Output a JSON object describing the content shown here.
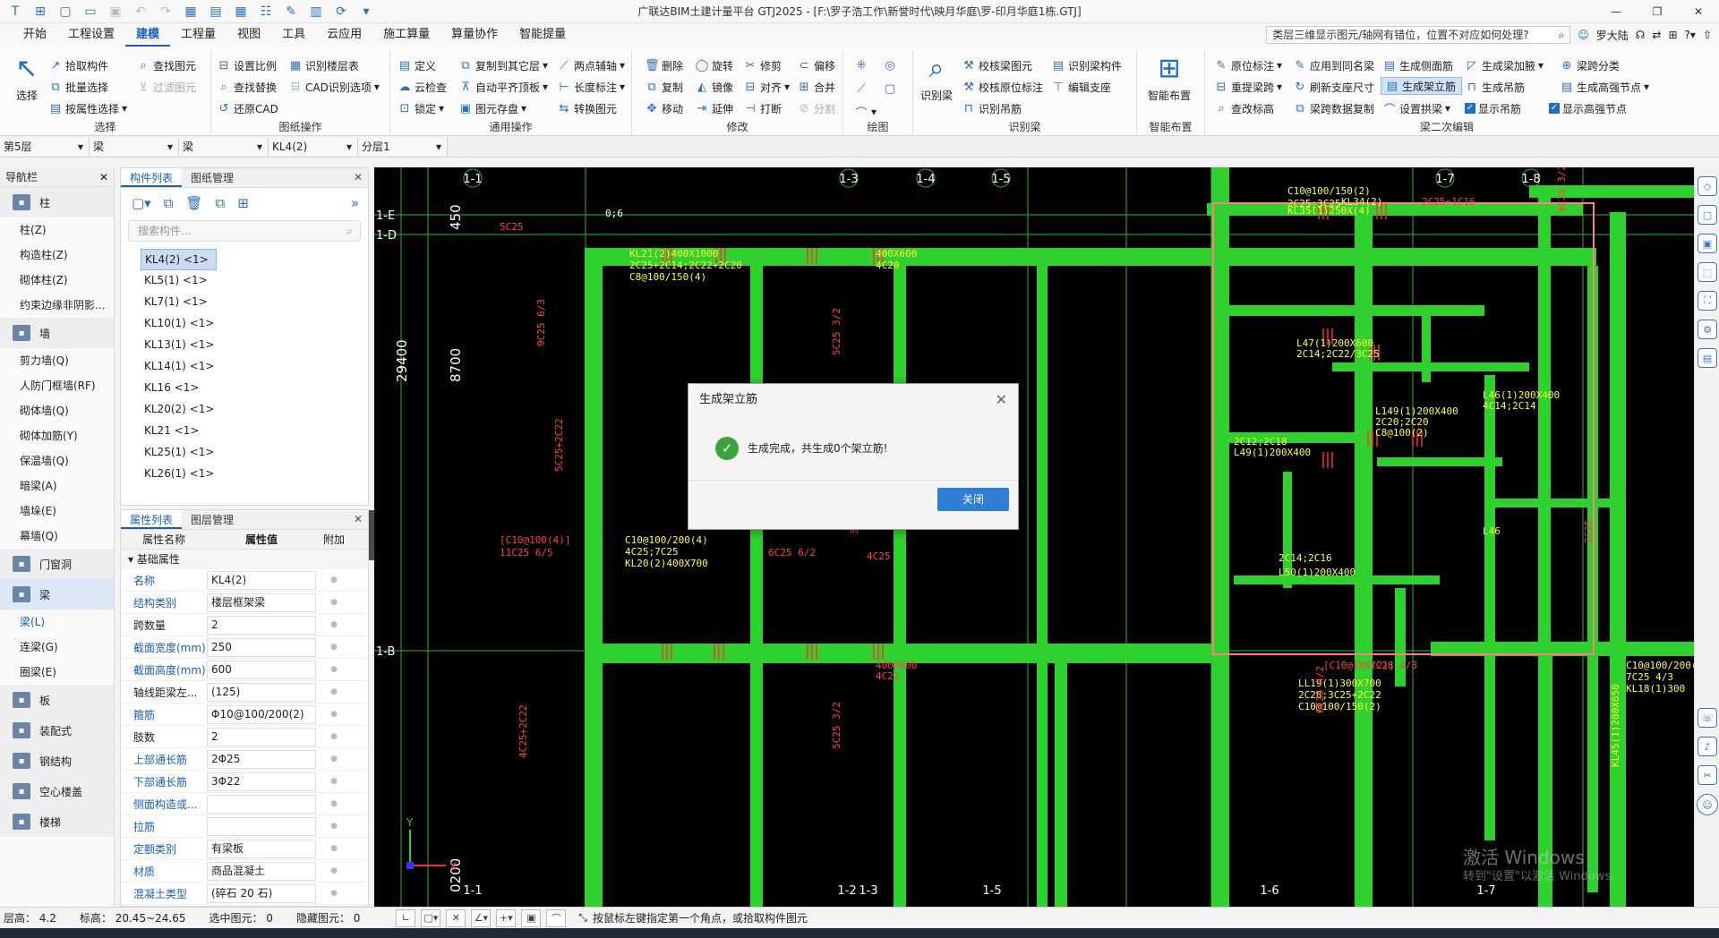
{
  "title_bar": {
    "title": "广联达BIM土建计量平台 GTJ2025 - [F:\\罗子浩工作\\新誉时代\\映月华庭\\罗-印月华庭1栋.GTJ]",
    "win_min": "—",
    "win_max": "❐",
    "win_close": "✕"
  },
  "menu": {
    "items": [
      "开始",
      "工程设置",
      "建模",
      "工程量",
      "视图",
      "工具",
      "云应用",
      "施工算量",
      "算量协作",
      "智能提量"
    ],
    "active": "建模",
    "question": "类层三维显示图元/轴网有错位，位置不对应如何处理?",
    "user": "罗大陆"
  },
  "ribbon": {
    "select": {
      "pick": "拾取构件",
      "batch": "批量选择",
      "by_prop": "按属性选择",
      "label": "选择",
      "big": "选择"
    },
    "drawing": {
      "find_elem": "查找图元",
      "filter_elem": "过滤图元",
      "set_scale": "设置比例",
      "find_replace": "查找替换",
      "restore_cad": "还原CAD",
      "recog_floor": "识别楼层表",
      "cad_options": "CAD识别选项",
      "label": "图纸操作"
    },
    "general": {
      "define": "定义",
      "copy_to": "复制到其它层",
      "two_point": "两点辅轴",
      "cloud_check": "云检查",
      "auto_align": "自动平齐顶板",
      "length_mark": "长度标注",
      "lock": "锁定",
      "save_elem": "图元存盘",
      "convert": "转换图元",
      "label": "通用操作"
    },
    "modify": {
      "delete": "删除",
      "rotate": "旋转",
      "trim": "修剪",
      "offset": "偏移",
      "copy": "复制",
      "mirror": "镜像",
      "align": "对齐",
      "merge": "合并",
      "move": "移动",
      "extend": "延伸",
      "break": "打断",
      "split": "分割",
      "label": "修改"
    },
    "draw": {
      "label": "绘图"
    },
    "recognize": {
      "recog_beam": "识别梁",
      "check_beam": "校核梁图元",
      "check_orig": "校核原位标注",
      "recog_hanger": "识别吊筋",
      "recog_member": "识别梁构件",
      "edit_support": "编辑支座",
      "label": "识别梁"
    },
    "smart": {
      "big": "智能布置",
      "label": "智能布置"
    },
    "second_edit": {
      "orig_mark": "原位标注",
      "apply_same": "应用到同名梁",
      "gen_side": "生成侧面筋",
      "gen_haunch": "生成梁加腋",
      "beam_span": "梁跨分类",
      "re_extract": "重提梁跨",
      "refresh_support": "刷新支座尺寸",
      "gen_erect": "生成架立筋",
      "gen_hanger": "生成吊筋",
      "gen_node": "生成高强节点",
      "check_mark": "查改标高",
      "span_copy": "梁跨数据复制",
      "set_arch": "设置拱梁",
      "show_hanger": "显示吊筋",
      "show_node": "显示高强节点",
      "label": "梁二次编辑"
    }
  },
  "selectors": {
    "floor": "第5层",
    "type": "梁",
    "sub": "梁",
    "member": "KL4(2)",
    "layer": "分层1"
  },
  "nav": {
    "title": "导航栏",
    "sections": [
      {
        "label": "柱",
        "icon": "column-icon",
        "items": [
          "柱(Z)",
          "构造柱(Z)",
          "砌体柱(Z)",
          "约束边缘非阴影..."
        ]
      },
      {
        "label": "墙",
        "icon": "wall-icon",
        "items": [
          "剪力墙(Q)",
          "人防门框墙(RF)",
          "砌体墙(Q)",
          "砌体加筋(Y)",
          "保温墙(Q)",
          "暗梁(A)",
          "墙垛(E)",
          "幕墙(Q)"
        ]
      },
      {
        "label": "门窗洞",
        "icon": "door-icon",
        "items": []
      },
      {
        "label": "梁",
        "icon": "beam-icon",
        "items": [
          "梁(L)",
          "连梁(G)",
          "圈梁(E)"
        ]
      },
      {
        "label": "板",
        "icon": "slab-icon",
        "items": []
      },
      {
        "label": "装配式",
        "icon": "prefab-icon",
        "items": []
      },
      {
        "label": "钢结构",
        "icon": "steel-icon",
        "items": []
      },
      {
        "label": "空心楼盖",
        "icon": "hollow-icon",
        "items": []
      },
      {
        "label": "楼梯",
        "icon": "stair-icon",
        "items": []
      }
    ]
  },
  "components": {
    "tab1": "构件列表",
    "tab2": "图纸管理",
    "search_placeholder": "搜索构件...",
    "items": [
      "KL4(2) <1>",
      "KL5(1) <1>",
      "KL7(1) <1>",
      "KL10(1) <1>",
      "KL13(1) <1>",
      "KL14(1) <1>",
      "KL16 <1>",
      "KL20(2) <1>",
      "KL21 <1>",
      "KL25(1) <1>",
      "KL26(1) <1>"
    ],
    "selected_index": 0
  },
  "properties": {
    "tab1": "属性列表",
    "tab2": "图层管理",
    "col_name": "属性名称",
    "col_value": "属性值",
    "col_add": "附加",
    "group": "基础属性",
    "rows": [
      {
        "name": "名称",
        "value": "KL4(2)",
        "blue": true
      },
      {
        "name": "结构类别",
        "value": "楼层框架梁",
        "blue": true
      },
      {
        "name": "跨数量",
        "value": "2",
        "blue": false
      },
      {
        "name": "截面宽度(mm)",
        "value": "250",
        "blue": true
      },
      {
        "name": "截面高度(mm)",
        "value": "600",
        "blue": true
      },
      {
        "name": "轴线距梁左...",
        "value": "(125)",
        "blue": false
      },
      {
        "name": "箍筋",
        "value": "Φ10@100/200(2)",
        "blue": true
      },
      {
        "name": "肢数",
        "value": "2",
        "blue": false
      },
      {
        "name": "上部通长筋",
        "value": "2Φ25",
        "blue": true
      },
      {
        "name": "下部通长筋",
        "value": "3Φ22",
        "blue": true
      },
      {
        "name": "侧面构造或...",
        "value": "",
        "blue": true
      },
      {
        "name": "拉筋",
        "value": "",
        "blue": true
      },
      {
        "name": "定额类别",
        "value": "有梁板",
        "blue": true
      },
      {
        "name": "材质",
        "value": "商品混凝土",
        "blue": true
      },
      {
        "name": "混凝土类型",
        "value": "(碎石 20 石)",
        "blue": true
      }
    ]
  },
  "canvas": {
    "axis_top": [
      "1-1",
      "1-3",
      "1-4",
      "1-5",
      "1-7",
      "1-8"
    ],
    "axis_bottom": [
      "1-1",
      "1-2",
      "1-3",
      "1-5",
      "1-6",
      "1-7"
    ],
    "axis_left": [
      "1-E",
      "1-D",
      "1-B"
    ],
    "dims": [
      "450",
      "8700",
      "29400",
      "0200"
    ],
    "labels": [
      "KL21(2)400X1000",
      "2C25+2C14;2C22+2C20",
      "C8@100/150(4)",
      "5C25",
      "0;6",
      "400X600",
      "4C20",
      "9C25 6/3",
      "5C25+2C22",
      "5C25 3/2",
      "3C22",
      "C10@100/200(4)",
      "4C25;7C25",
      "KL20(2)400X700",
      "[C10@100(4)]",
      "11C25 6/5",
      "6C25 6/2",
      "4C25",
      "C10@100/150(2)",
      "2C25;3C25",
      "KL35(1)250X(4)",
      "6C25 3/2",
      "2C25+1C16",
      "KL34(2)",
      "L47(1)200X600",
      "2C14;2C22/3C25",
      "L46(1)200X400",
      "4C14;2C14",
      "L149(1)200X400",
      "2C20;2C20",
      "C8@100(2)",
      "2C12;2C18",
      "L49(1)200X400",
      "2C14;2C16",
      "L50(1)200X400",
      "L46",
      "7C28 4/3",
      "LL19(1)300X700",
      "2C28;3C25+2C22",
      "C10@100/150(2)",
      "[C10@100(2)]",
      "400X600",
      "4C22",
      "4C25+2C22",
      "5C25 3/2",
      "6C25 4/2",
      "KL45(1)200X650",
      "C10@100/200(2)",
      "7C25 4/3",
      "KL18(1)300",
      "2C25"
    ],
    "ucs_x": "X",
    "ucs_y": "Y"
  },
  "dialog": {
    "title": "生成架立筋",
    "message": "生成完成，共生成0个架立筋!",
    "button": "关闭"
  },
  "status": {
    "floor_height": "层高： 4.2",
    "elevation": "标高： 20.45~24.65",
    "selected": "选中图元： 0",
    "hidden": "隐藏图元： 0",
    "hint": "按鼠标左键指定第一个角点，或拾取构件图元"
  },
  "watermark": {
    "line1": "激活 Windows",
    "line2": "转到\"设置\"以激活 Windows。"
  },
  "colors": {
    "beam": "#2ed12e",
    "canvas": "#000000",
    "accent": "#1a5fb4",
    "label_yellow": "#ffff33",
    "label_red": "#ff4040",
    "axis": "#2fb62f"
  }
}
